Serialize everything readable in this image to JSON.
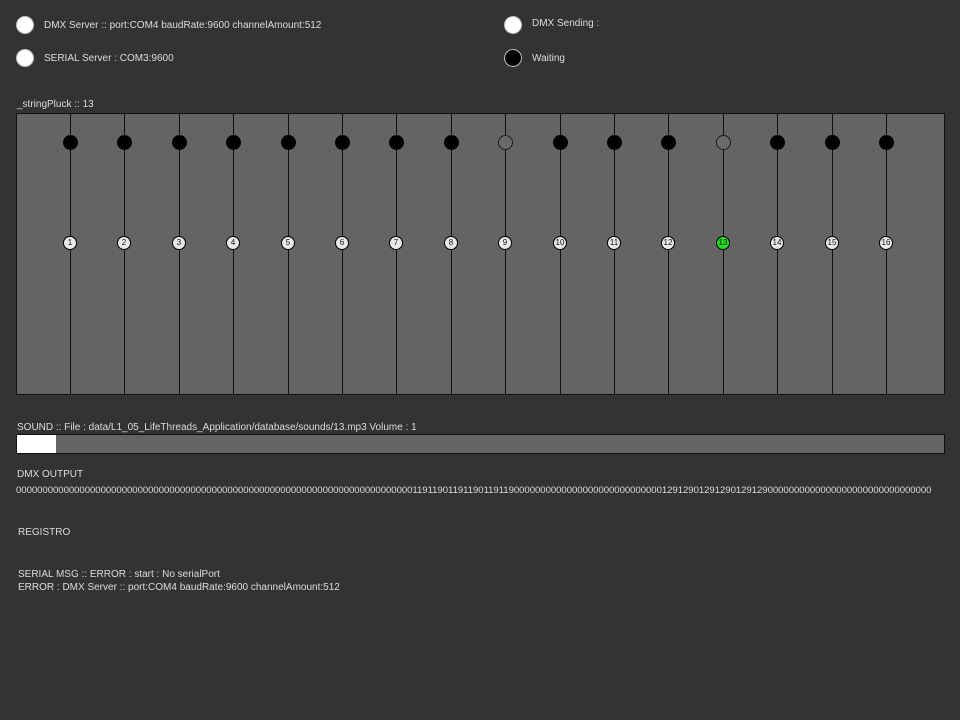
{
  "header": {
    "dmx_server_label": "DMX Server ::  port:COM4 baudRate:9600 channelAmount:512",
    "serial_server_label": "SERIAL Server : COM3:9600",
    "dmx_sending_label": "DMX Sending :",
    "waiting_label": "Waiting",
    "colors": {
      "light": "#ffffff",
      "dark": "#000000"
    }
  },
  "strings_panel": {
    "label": "_stringPluck :: 13",
    "active_index": 13,
    "strings": [
      {
        "num": "1",
        "top_state": "on"
      },
      {
        "num": "2",
        "top_state": "on"
      },
      {
        "num": "3",
        "top_state": "on"
      },
      {
        "num": "4",
        "top_state": "on"
      },
      {
        "num": "5",
        "top_state": "on"
      },
      {
        "num": "6",
        "top_state": "on"
      },
      {
        "num": "7",
        "top_state": "on"
      },
      {
        "num": "8",
        "top_state": "on"
      },
      {
        "num": "9",
        "top_state": "off"
      },
      {
        "num": "10",
        "top_state": "on"
      },
      {
        "num": "11",
        "top_state": "on"
      },
      {
        "num": "12",
        "top_state": "on"
      },
      {
        "num": "13",
        "top_state": "off"
      },
      {
        "num": "14",
        "top_state": "on"
      },
      {
        "num": "15",
        "top_state": "on"
      },
      {
        "num": "16",
        "top_state": "on"
      }
    ],
    "colors": {
      "on": "#000000",
      "off": "#6a6a6a",
      "active": "#22dd22",
      "label_bg": "#e8e8e8"
    }
  },
  "sound": {
    "label": "SOUND ::  File : data/L1_05_LifeThreads_Application/database/sounds/13.mp3 Volume : 1",
    "progress": 0.042
  },
  "dmx_output": {
    "label": "DMX OUTPUT",
    "values": "000000000000000000000000000000000000000000000000000000000000000000000000000119119011911901191190000000000000000000000000000129129012912901291290000000000000000000000000000000"
  },
  "registro": {
    "label": "REGISTRO"
  },
  "log": {
    "line1": "SERIAL MSG :: ERROR : start : No serialPort",
    "line2": "ERROR : DMX Server ::  port:COM4 baudRate:9600 channelAmount:512"
  }
}
